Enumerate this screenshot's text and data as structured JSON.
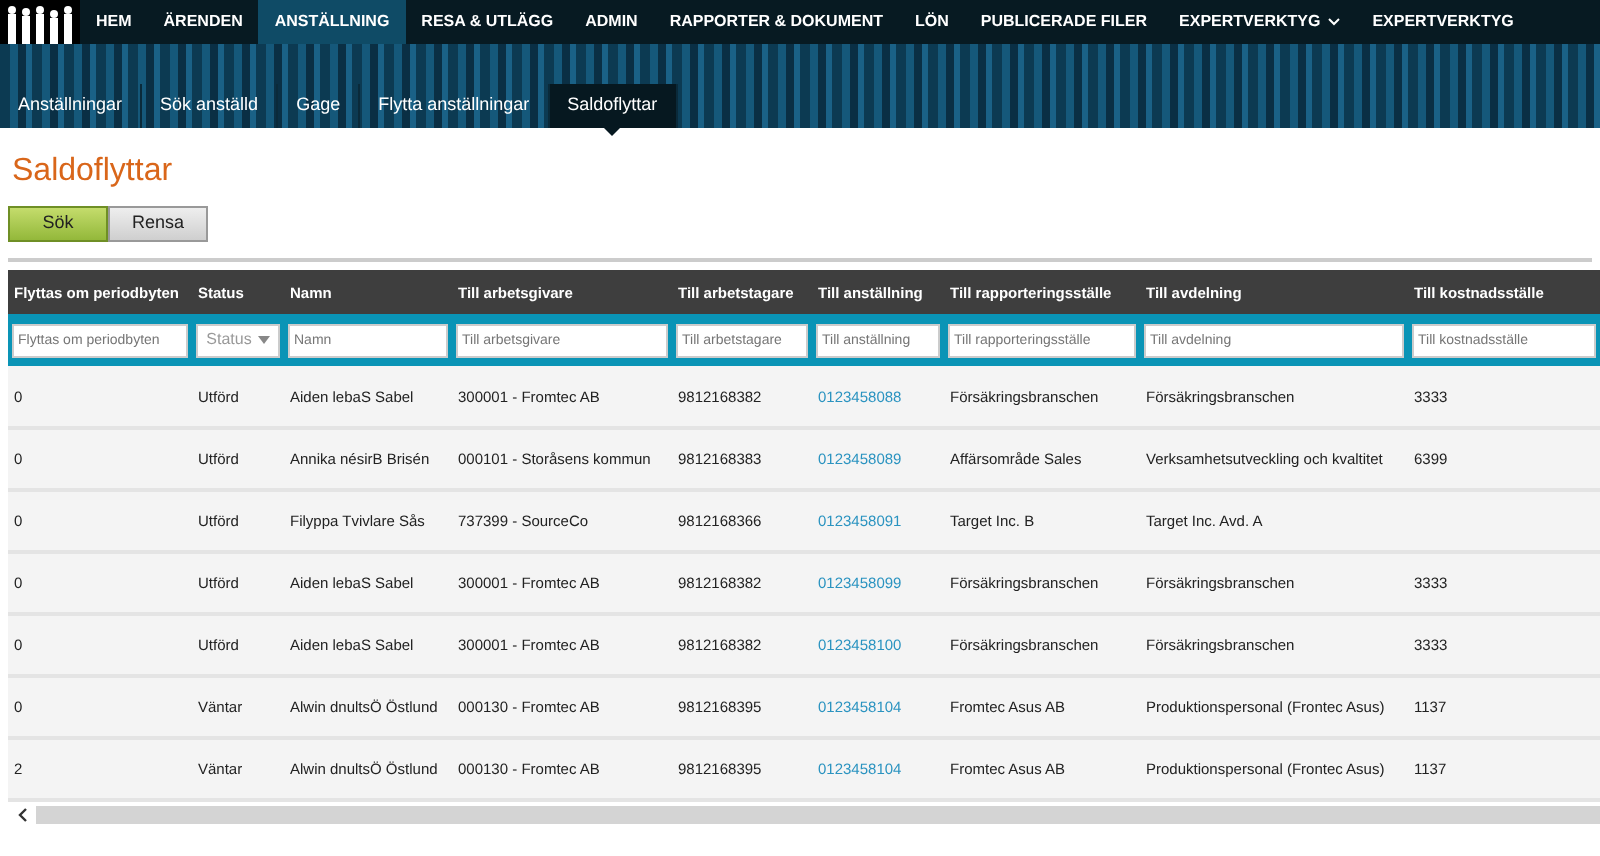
{
  "nav": [
    {
      "label": "HEM",
      "selected": false,
      "dropdown": false
    },
    {
      "label": "ÄRENDEN",
      "selected": false,
      "dropdown": false
    },
    {
      "label": "ANSTÄLLNING",
      "selected": true,
      "dropdown": false
    },
    {
      "label": "RESA & UTLÄGG",
      "selected": false,
      "dropdown": false
    },
    {
      "label": "ADMIN",
      "selected": false,
      "dropdown": false
    },
    {
      "label": "RAPPORTER & DOKUMENT",
      "selected": false,
      "dropdown": false
    },
    {
      "label": "LÖN",
      "selected": false,
      "dropdown": false
    },
    {
      "label": "PUBLICERADE FILER",
      "selected": false,
      "dropdown": false
    },
    {
      "label": "EXPERTVERKTYG",
      "selected": false,
      "dropdown": true
    },
    {
      "label": "EXPERTVERKTYG",
      "selected": false,
      "dropdown": false
    }
  ],
  "subnav": [
    {
      "label": "Anställningar",
      "selected": false
    },
    {
      "label": "Sök anställd",
      "selected": false
    },
    {
      "label": "Gage",
      "selected": false
    },
    {
      "label": "Flytta anställningar",
      "selected": false
    },
    {
      "label": "Saldoflyttar",
      "selected": true
    }
  ],
  "title": "Saldoflyttar",
  "buttons": [
    {
      "label": "Sök",
      "kind": "primary"
    },
    {
      "label": "Rensa",
      "kind": "secondary"
    }
  ],
  "table": {
    "columns": [
      {
        "label": "Flyttas om periodbyten",
        "kind": "text",
        "filter": {
          "kind": "input",
          "placeholder": "Flyttas om periodbyten"
        }
      },
      {
        "label": "Status",
        "kind": "text",
        "filter": {
          "kind": "select",
          "placeholder": "Status"
        }
      },
      {
        "label": "Namn",
        "kind": "text",
        "filter": {
          "kind": "input",
          "placeholder": "Namn"
        }
      },
      {
        "label": "Till arbetsgivare",
        "kind": "text",
        "filter": {
          "kind": "input",
          "placeholder": "Till arbetsgivare"
        }
      },
      {
        "label": "Till arbetstagare",
        "kind": "text",
        "filter": {
          "kind": "input",
          "placeholder": "Till arbetstagare"
        }
      },
      {
        "label": "Till anställning",
        "kind": "link",
        "filter": {
          "kind": "input",
          "placeholder": "Till anställning"
        }
      },
      {
        "label": "Till rapporteringsställe",
        "kind": "text",
        "filter": {
          "kind": "input",
          "placeholder": "Till rapporteringsställe"
        }
      },
      {
        "label": "Till avdelning",
        "kind": "text",
        "filter": {
          "kind": "input",
          "placeholder": "Till avdelning"
        }
      },
      {
        "label": "Till kostnadsställe",
        "kind": "text",
        "filter": {
          "kind": "input",
          "placeholder": "Till kostnadsställe"
        }
      }
    ],
    "rows": [
      [
        "0",
        "Utförd",
        "Aiden lebaS Sabel",
        "300001 - Fromtec AB",
        "9812168382",
        "0123458088",
        "Försäkringsbranschen",
        "Försäkringsbranschen",
        "3333"
      ],
      [
        "0",
        "Utförd",
        "Annika nésirB Brisén",
        "000101 - Storåsens kommun",
        "9812168383",
        "0123458089",
        "Affärsområde Sales",
        "Verksamhetsutveckling och kvaltitet",
        "6399"
      ],
      [
        "0",
        "Utförd",
        "Filyppa Tvivlare Sås",
        "737399 - SourceCo",
        "9812168366",
        "0123458091",
        "Target Inc. B",
        "Target Inc. Avd. A",
        ""
      ],
      [
        "0",
        "Utförd",
        "Aiden lebaS Sabel",
        "300001 - Fromtec AB",
        "9812168382",
        "0123458099",
        "Försäkringsbranschen",
        "Försäkringsbranschen",
        "3333"
      ],
      [
        "0",
        "Utförd",
        "Aiden lebaS Sabel",
        "300001 - Fromtec AB",
        "9812168382",
        "0123458100",
        "Försäkringsbranschen",
        "Försäkringsbranschen",
        "3333"
      ],
      [
        "0",
        "Väntar",
        "Alwin dnultsÖ Östlund",
        "000130 - Fromtec AB",
        "9812168395",
        "0123458104",
        "Fromtec Asus AB",
        "Produktionspersonal (Frontec Asus)",
        "1137"
      ],
      [
        "2",
        "Väntar",
        "Alwin dnultsÖ Östlund",
        "000130 - Fromtec AB",
        "9812168395",
        "0123458104",
        "Fromtec Asus AB",
        "Produktionspersonal (Frontec Asus)",
        "1137"
      ]
    ]
  }
}
